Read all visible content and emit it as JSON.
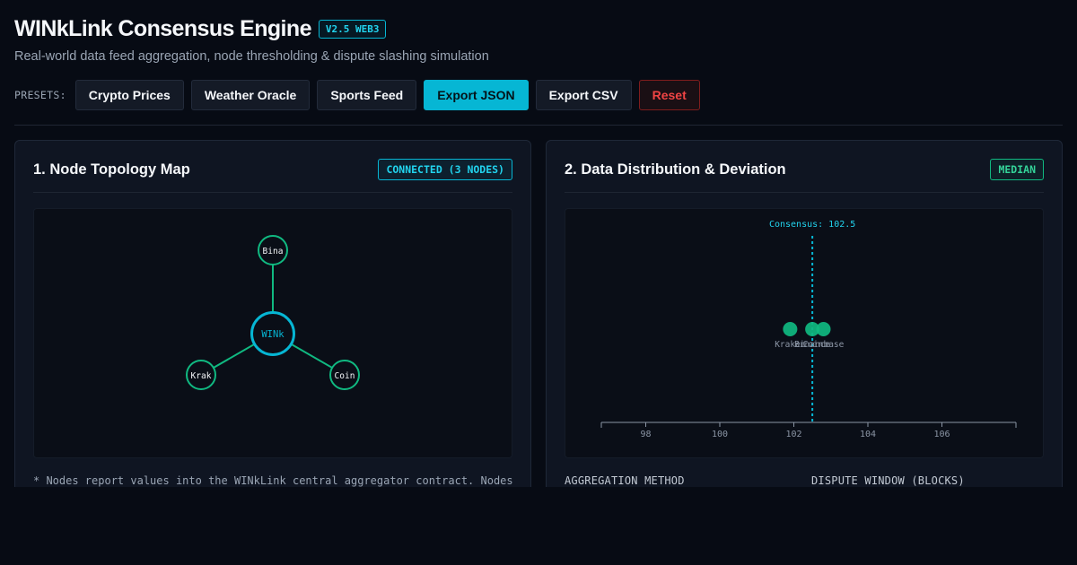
{
  "app": {
    "title": "WINkLink Consensus Engine",
    "version_badge": "V2.5 WEB3",
    "subtitle": "Real-world data feed aggregation, node thresholding & dispute slashing simulation"
  },
  "toolbar": {
    "presets_label": "PRESETS:",
    "buttons": {
      "crypto_prices": "Crypto Prices",
      "weather_oracle": "Weather Oracle",
      "sports_feed": "Sports Feed",
      "export_json": "Export JSON",
      "export_csv": "Export CSV",
      "reset": "Reset"
    }
  },
  "topology_panel": {
    "title": "1. Node Topology Map",
    "status": "CONNECTED (3 NODES)",
    "aggregator_label": "WINk",
    "nodes": [
      "Bina",
      "Krak",
      "Coin"
    ],
    "footnote": "* Nodes report values into the WINkLink central aggregator contract. Nodes"
  },
  "distribution_panel": {
    "title": "2. Data Distribution & Deviation",
    "method_badge": "MEDIAN",
    "aggregation_method_label": "AGGREGATION METHOD",
    "dispute_window_label": "DISPUTE WINDOW (BLOCKS)"
  },
  "chart_data": {
    "type": "scatter",
    "consensus_label": "Consensus: 102.5",
    "consensus_value": 102.5,
    "xlim": [
      96.8,
      108.0
    ],
    "xticks": [
      98,
      100,
      102,
      104,
      106
    ],
    "points": [
      {
        "name": "Kraken",
        "x": 101.9
      },
      {
        "name": "Binance",
        "x": 102.5
      },
      {
        "name": "Coinbase",
        "x": 102.8
      }
    ]
  },
  "colors": {
    "accent_cyan": "#06b6d4",
    "node_green": "#10b981",
    "danger_red": "#ef4444"
  }
}
